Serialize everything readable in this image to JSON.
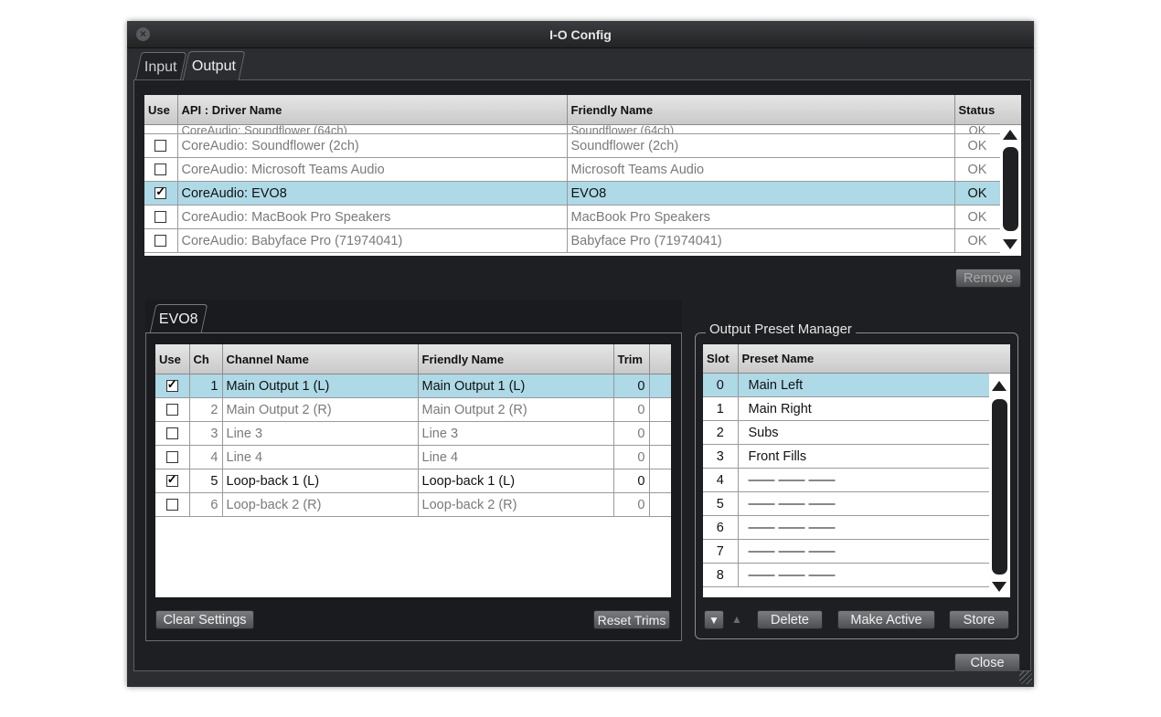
{
  "window": {
    "title": "I-O Config"
  },
  "tabs": [
    {
      "label": "Input"
    },
    {
      "label": "Output"
    }
  ],
  "drivers": {
    "headers": {
      "use": "Use",
      "api": "API : Driver Name",
      "friendly": "Friendly Name",
      "status": "Status"
    },
    "partial_row": {
      "api": "CoreAudio: Soundflower (64ch)",
      "friendly": "Soundflower (64ch)",
      "status": "OK"
    },
    "rows": [
      {
        "checked": false,
        "api": "CoreAudio: Soundflower (2ch)",
        "friendly": "Soundflower (2ch)",
        "status": "OK"
      },
      {
        "checked": false,
        "api": "CoreAudio: Microsoft Teams Audio",
        "friendly": "Microsoft Teams Audio",
        "status": "OK"
      },
      {
        "checked": true,
        "api": "CoreAudio: EVO8",
        "friendly": "EVO8",
        "status": "OK"
      },
      {
        "checked": false,
        "api": "CoreAudio: MacBook Pro Speakers",
        "friendly": "MacBook Pro Speakers",
        "status": "OK"
      },
      {
        "checked": false,
        "api": "CoreAudio: Babyface Pro (71974041)",
        "friendly": "Babyface Pro (71974041)",
        "status": "OK"
      }
    ],
    "remove_label": "Remove"
  },
  "device": {
    "tab_label": "EVO8",
    "headers": {
      "use": "Use",
      "ch": "Ch",
      "channel": "Channel Name",
      "friendly": "Friendly Name",
      "trim": "Trim"
    },
    "rows": [
      {
        "checked": true,
        "ch": "1",
        "channel": "Main Output 1 (L)",
        "friendly": "Main Output 1 (L)",
        "trim": "0"
      },
      {
        "checked": false,
        "ch": "2",
        "channel": "Main Output 2 (R)",
        "friendly": "Main Output 2 (R)",
        "trim": "0"
      },
      {
        "checked": false,
        "ch": "3",
        "channel": "Line 3",
        "friendly": "Line 3",
        "trim": "0"
      },
      {
        "checked": false,
        "ch": "4",
        "channel": "Line 4",
        "friendly": "Line 4",
        "trim": "0"
      },
      {
        "checked": true,
        "ch": "5",
        "channel": "Loop-back 1 (L)",
        "friendly": "Loop-back 1 (L)",
        "trim": "0"
      },
      {
        "checked": false,
        "ch": "6",
        "channel": "Loop-back 2 (R)",
        "friendly": "Loop-back 2 (R)",
        "trim": "0"
      }
    ],
    "clear_label": "Clear Settings",
    "reset_label": "Reset Trims"
  },
  "presets": {
    "title": "Output Preset Manager",
    "headers": {
      "slot": "Slot",
      "name": "Preset Name"
    },
    "rows": [
      {
        "slot": "0",
        "name": "Main Left"
      },
      {
        "slot": "1",
        "name": "Main Right"
      },
      {
        "slot": "2",
        "name": "Subs"
      },
      {
        "slot": "3",
        "name": "Front Fills"
      },
      {
        "slot": "4",
        "name": "—— —— ——"
      },
      {
        "slot": "5",
        "name": "—— —— ——"
      },
      {
        "slot": "6",
        "name": "—— —— ——"
      },
      {
        "slot": "7",
        "name": "—— —— ——"
      },
      {
        "slot": "8",
        "name": "—— —— ——"
      }
    ],
    "down_label": "▼",
    "up_label": "▲",
    "delete_label": "Delete",
    "make_active_label": "Make Active",
    "store_label": "Store"
  },
  "close_label": "Close",
  "icons": {
    "close": "close-icon",
    "scroll_up": "arrow-up-icon",
    "scroll_down": "arrow-down-icon",
    "check": "checkmark-icon"
  }
}
